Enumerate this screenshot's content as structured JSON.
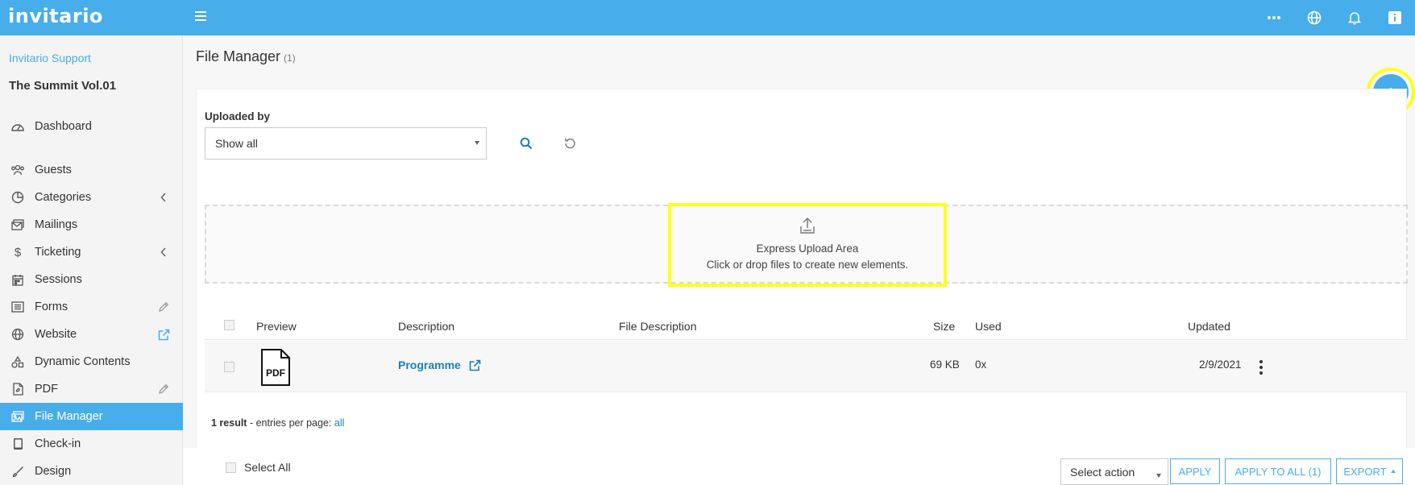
{
  "app": {
    "logo": "invitario"
  },
  "topbar": {
    "icons": [
      "more-horizontal-icon",
      "globe-icon",
      "bell-icon",
      "info-icon"
    ]
  },
  "sidebar": {
    "org": "Invitario Support",
    "event": "The Summit Vol.01",
    "items": [
      {
        "label": "Dashboard",
        "icon": "dashboard-icon"
      },
      {
        "label": "Guests",
        "icon": "guests-icon"
      },
      {
        "label": "Categories",
        "icon": "categories-icon",
        "right": "chevron-left-icon"
      },
      {
        "label": "Mailings",
        "icon": "mailings-icon"
      },
      {
        "label": "Ticketing",
        "icon": "dollar-icon",
        "right": "chevron-left-icon"
      },
      {
        "label": "Sessions",
        "icon": "calendar-icon"
      },
      {
        "label": "Forms",
        "icon": "forms-icon",
        "right": "pencil-icon"
      },
      {
        "label": "Website",
        "icon": "globe-icon",
        "right": "external-link-icon"
      },
      {
        "label": "Dynamic Contents",
        "icon": "shapes-icon"
      },
      {
        "label": "PDF",
        "icon": "pdf-icon",
        "right": "pencil-icon"
      },
      {
        "label": "File Manager",
        "icon": "file-manager-icon",
        "active": true
      },
      {
        "label": "Check-in",
        "icon": "tablet-icon"
      },
      {
        "label": "Design",
        "icon": "brush-icon"
      }
    ]
  },
  "page": {
    "title": "File Manager",
    "count": "(1)"
  },
  "filter": {
    "label": "Uploaded by",
    "selected": "Show all"
  },
  "upload": {
    "title": "Express Upload Area",
    "subtitle": "Click or drop files to create new elements."
  },
  "table": {
    "headers": {
      "preview": "Preview",
      "description": "Description",
      "file_description": "File Description",
      "size": "Size",
      "used": "Used",
      "updated": "Updated"
    },
    "rows": [
      {
        "preview_label": "PDF",
        "description": "Programme",
        "file_description": "",
        "size": "69 KB",
        "used": "0x",
        "updated": "2/9/2021"
      }
    ]
  },
  "results": {
    "count": "1 result",
    "text": " - entries per page: ",
    "link": "all"
  },
  "footer": {
    "select_all": "Select All",
    "action_placeholder": "Select action",
    "apply": "APPLY",
    "apply_all": "APPLY TO ALL (1)",
    "export": "EXPORT"
  },
  "colors": {
    "primary": "#47adeb",
    "link": "#1b7fb8",
    "highlight": "#ffff1a"
  }
}
